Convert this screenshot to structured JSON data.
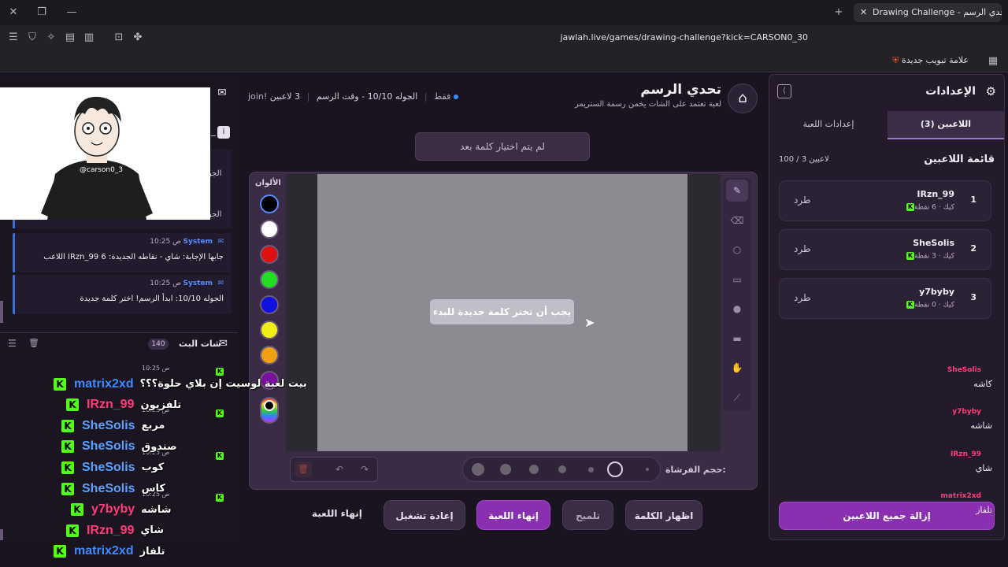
{
  "browser": {
    "tab_title": "Drawing Challenge - تحدي الرسم",
    "url": "jawlah.live/games/drawing-challenge?kick=CARSON0_30",
    "bookmark_label": "علامة تبويب جديدة"
  },
  "header": {
    "title": "تحدي الرسم",
    "subtitle": "لعبة تعتمد على الشات يخمن رسمة الستريمر",
    "players_count": "3 لاعبين",
    "round_info": "الجوله 10/10 - وقت الرسم",
    "join_hint": "join! فقط",
    "word_status": "لم يتم اختيار كلمة بعد"
  },
  "settings": {
    "title": "الإعدادات",
    "tabs": [
      "اللاعبين (3)",
      "إعدادات اللعبة"
    ],
    "players_heading": "قائمة اللاعبين",
    "players_capacity": "100 / 3 لاعبين",
    "players": [
      {
        "rank": "1",
        "name": "IRzn_99",
        "meta": "كيك · 6 نقطة",
        "kick": "طرد"
      },
      {
        "rank": "2",
        "name": "SheSolis",
        "meta": "كيك · 3 نقطة",
        "kick": "طرد"
      },
      {
        "rank": "3",
        "name": "y7byby",
        "meta": "كيك · 0 نقطة",
        "kick": "طرد"
      }
    ],
    "remove_all": "إزالة جميع اللاعبين"
  },
  "canvas": {
    "colors_label": "الألوان",
    "colors": [
      "#000000",
      "#ffffff",
      "#e01010",
      "#22dd22",
      "#1010e0",
      "#f2ee12",
      "#f2a012",
      "#7a10a0"
    ],
    "overlay_message": "يجب أن تختر كلمة جديدة للبدء",
    "brush_size_label": "حجم الفرشاة:"
  },
  "actions": {
    "end_game_link": "إنهاء اللعبة",
    "restart": "إعادة تشغيل",
    "end_game": "إنهاء اللعبة",
    "hint": "تلميح",
    "reveal": "اظهار الكلمة"
  },
  "chat": {
    "system_messages": [
      {
        "sender": "System",
        "time": "10:25 ص",
        "text": "اللاعب IRzn_99 جابها الإجابة: شاي - نقاطه الجديدة: 6"
      },
      {
        "sender": "System",
        "time": "10:25 ص",
        "text": "الجوله 10/10: ابدأ الرسم! اختر كلمة جديدة"
      }
    ],
    "partial_messages": [
      "الجو",
      "الجو"
    ],
    "stream_chat_title": "شات البث",
    "stream_chat_count": "140",
    "stream_rows": [
      {
        "user": "SheSolis",
        "time": "10:25 ص",
        "text": "كاشه"
      },
      {
        "user": "y7byby",
        "time": "10:25 ص",
        "text": "شاشه"
      },
      {
        "user": "IRzn_99",
        "time": "10:25 ص",
        "text": "شاي"
      },
      {
        "user": "matrix2xd",
        "time": "10:25 ص",
        "text": "تلفاز"
      }
    ]
  },
  "overlay_chat": [
    {
      "user": "matrix2xd",
      "color": "#3c8cff",
      "text": "بيت لعبة لوسيت إن بلاي حلوة؟؟؟"
    },
    {
      "user": "IRzn_99",
      "color": "#ff3c78",
      "text": "تلفزيون"
    },
    {
      "user": "SheSolis",
      "color": "#5aa0ff",
      "text": "مربع"
    },
    {
      "user": "SheSolis",
      "color": "#5aa0ff",
      "text": "صندوق"
    },
    {
      "user": "SheSolis",
      "color": "#5aa0ff",
      "text": "كوب"
    },
    {
      "user": "SheSolis",
      "color": "#5aa0ff",
      "text": "كاس"
    },
    {
      "user": "y7byby",
      "color": "#ff3c78",
      "text": "شاشه"
    },
    {
      "user": "IRzn_99",
      "color": "#ff3c78",
      "text": "شاي"
    },
    {
      "user": "matrix2xd",
      "color": "#3c8cff",
      "text": "تلفاز"
    }
  ],
  "webcam": {
    "shirt_text": "@carson0_3"
  }
}
